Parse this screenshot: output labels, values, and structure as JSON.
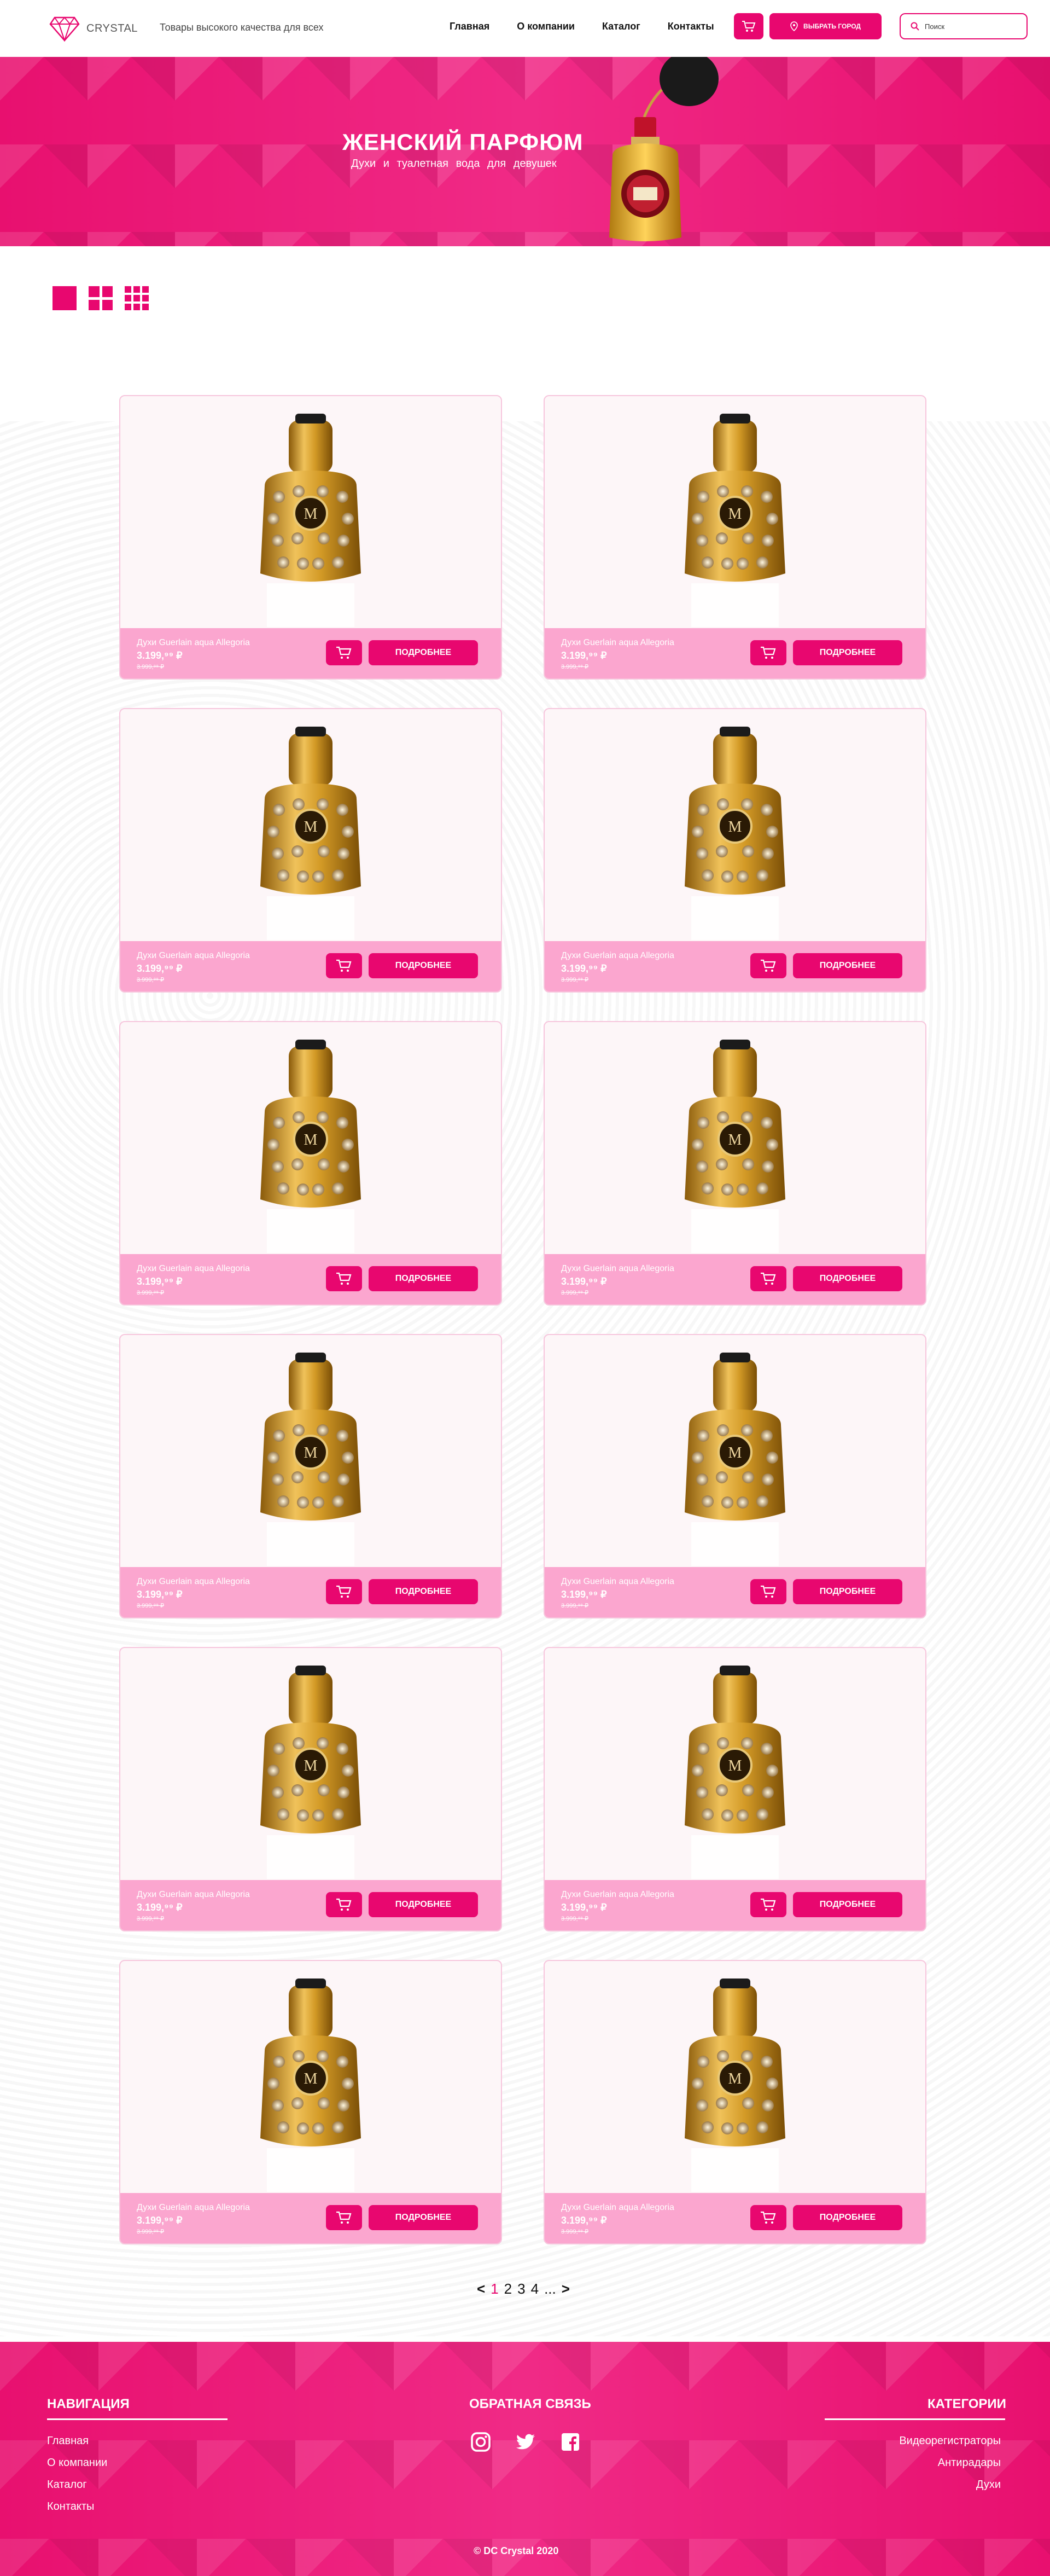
{
  "header": {
    "logo_text": "CRYSTAL",
    "tagline": "Товары высокого качества для всех",
    "nav": [
      "Главная",
      "О компании",
      "Каталог",
      "Контакты"
    ],
    "city_button": "ВЫБРАТЬ ГОРОД",
    "search_placeholder": "Поиск",
    "icons": {
      "cart": "cart-icon",
      "location": "location-pin-icon",
      "search": "search-icon",
      "logo": "diamond-icon"
    }
  },
  "banner": {
    "title": "ЖЕНСКИЙ ПАРФЮМ",
    "subtitle": "Духи и туалетная вода для девушек"
  },
  "view_modes": [
    "single",
    "grid-2",
    "grid-3"
  ],
  "products": [
    {
      "name": "Духи Guerlain aqua Allegoria",
      "price": "3.199,⁹⁹ ₽",
      "old_price": "3.999,⁹⁹ ₽",
      "button": "ПОДРОБНЕЕ"
    },
    {
      "name": "Духи Guerlain aqua Allegoria",
      "price": "3.199,⁹⁹ ₽",
      "old_price": "3.999,⁹⁹ ₽",
      "button": "ПОДРОБНЕЕ"
    },
    {
      "name": "Духи Guerlain aqua Allegoria",
      "price": "3.199,⁹⁹ ₽",
      "old_price": "3.999,⁹⁹ ₽",
      "button": "ПОДРОБНЕЕ"
    },
    {
      "name": "Духи Guerlain aqua Allegoria",
      "price": "3.199,⁹⁹ ₽",
      "old_price": "3.999,⁹⁹ ₽",
      "button": "ПОДРОБНЕЕ"
    },
    {
      "name": "Духи Guerlain aqua Allegoria",
      "price": "3.199,⁹⁹ ₽",
      "old_price": "3.999,⁹⁹ ₽",
      "button": "ПОДРОБНЕЕ"
    },
    {
      "name": "Духи Guerlain aqua Allegoria",
      "price": "3.199,⁹⁹ ₽",
      "old_price": "3.999,⁹⁹ ₽",
      "button": "ПОДРОБНЕЕ"
    },
    {
      "name": "Духи Guerlain aqua Allegoria",
      "price": "3.199,⁹⁹ ₽",
      "old_price": "3.999,⁹⁹ ₽",
      "button": "ПОДРОБНЕЕ"
    },
    {
      "name": "Духи Guerlain aqua Allegoria",
      "price": "3.199,⁹⁹ ₽",
      "old_price": "3.999,⁹⁹ ₽",
      "button": "ПОДРОБНЕЕ"
    },
    {
      "name": "Духи Guerlain aqua Allegoria",
      "price": "3.199,⁹⁹ ₽",
      "old_price": "3.999,⁹⁹ ₽",
      "button": "ПОДРОБНЕЕ"
    },
    {
      "name": "Духи Guerlain aqua Allegoria",
      "price": "3.199,⁹⁹ ₽",
      "old_price": "3.999,⁹⁹ ₽",
      "button": "ПОДРОБНЕЕ"
    },
    {
      "name": "Духи Guerlain aqua Allegoria",
      "price": "3.199,⁹⁹ ₽",
      "old_price": "3.999,⁹⁹ ₽",
      "button": "ПОДРОБНЕЕ"
    },
    {
      "name": "Духи Guerlain aqua Allegoria",
      "price": "3.199,⁹⁹ ₽",
      "old_price": "3.999,⁹⁹ ₽",
      "button": "ПОДРОБНЕЕ"
    }
  ],
  "pagination": {
    "prev": "<",
    "pages": [
      "1",
      "2",
      "3",
      "4"
    ],
    "ellipsis": "...",
    "next": ">",
    "current": "1"
  },
  "footer": {
    "nav_title": "НАВИГАЦИЯ",
    "nav_links": [
      "Главная",
      "О компании",
      "Каталог",
      "Контакты"
    ],
    "feedback_title": "ОБРАТНАЯ СВЯЗЬ",
    "social": [
      "instagram-icon",
      "twitter-icon",
      "facebook-icon"
    ],
    "categories_title": "КАТЕГОРИИ",
    "categories": [
      "Видеорегистраторы",
      "Антирадары",
      "Духи"
    ],
    "copyright": "© DC Crystal 2020"
  },
  "colors": {
    "accent": "#e8076f",
    "card_bar": "#fba6cf",
    "card_bg": "#fdf6f8"
  }
}
